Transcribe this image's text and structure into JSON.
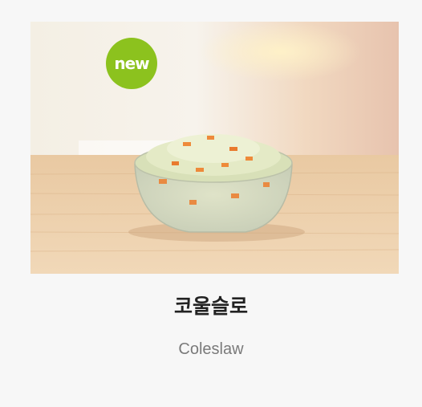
{
  "product": {
    "badge": "new",
    "name_ko": "코울슬로",
    "name_en": "Coleslaw",
    "badge_color": "#8cc21e"
  }
}
